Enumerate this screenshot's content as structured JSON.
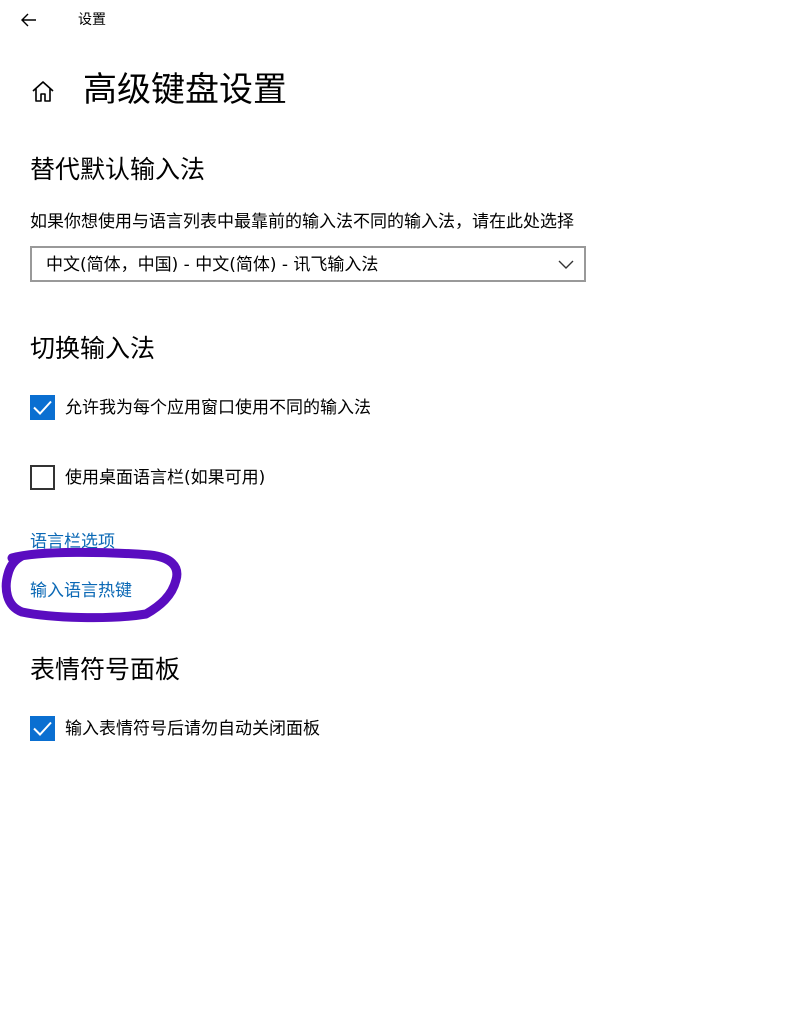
{
  "header": {
    "app_title": "设置",
    "back_icon": "back-arrow-icon"
  },
  "page": {
    "title": "高级键盘设置",
    "home_icon": "home-icon"
  },
  "override_section": {
    "title": "替代默认输入法",
    "description": "如果你想使用与语言列表中最靠前的输入法不同的输入法，请在此处选择",
    "dropdown_value": "中文(简体，中国) - 中文(简体) - 讯飞输入法"
  },
  "switch_section": {
    "title": "切换输入法",
    "checkbox_per_app": {
      "label": "允许我为每个应用窗口使用不同的输入法",
      "checked": true
    },
    "checkbox_desktop_bar": {
      "label": "使用桌面语言栏(如果可用)",
      "checked": false
    },
    "link_language_bar": "语言栏选项",
    "link_hotkeys": "输入语言热键"
  },
  "emoji_section": {
    "title": "表情符号面板",
    "checkbox_auto_close": {
      "label": "输入表情符号后请勿自动关闭面板",
      "checked": true
    }
  },
  "colors": {
    "accent": "#0a6fd1",
    "link": "#0a68b5",
    "annotation": "#5a0dc0"
  }
}
